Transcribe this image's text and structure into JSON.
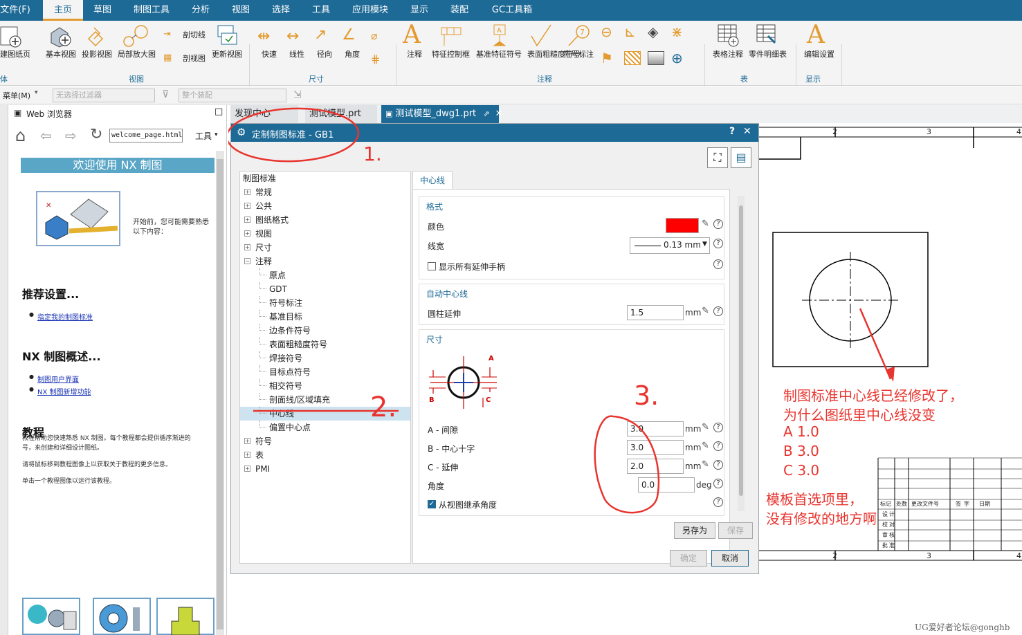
{
  "menu": {
    "file": "文件(F)",
    "tabs": [
      "主页",
      "草图",
      "制图工具",
      "分析",
      "视图",
      "选择",
      "工具",
      "应用模块",
      "显示",
      "装配",
      "GC工具箱"
    ]
  },
  "ribbon": {
    "view_group": {
      "new_sheet": "建图纸页",
      "base_view": "基本视图",
      "projected_view": "投影视图",
      "detail_view": "局部放大图",
      "section_line": "剖切线",
      "section_view": "剖视图",
      "update_view": "更新视图",
      "label": "视图"
    },
    "dim_group": {
      "rapid": "快速",
      "linear": "线性",
      "radial": "径向",
      "angular": "角度",
      "label": "尺寸"
    },
    "annot_group": {
      "note": "注释",
      "fcf": "特征控制框",
      "datum_feature": "基准特征符号",
      "surface_finish": "表面粗糙度符号",
      "id_symbol": "符号标注",
      "label": "注释"
    },
    "table_group": {
      "tabular_note": "表格注释",
      "parts_list": "零件明细表",
      "label": "表"
    },
    "display_group": {
      "edit_settings": "编辑设置",
      "label": "显示"
    },
    "left_cut": "体"
  },
  "filterbar": {
    "menu": "菜单(M)",
    "filter_placeholder": "无选择过滤器",
    "assembly_placeholder": "整个装配"
  },
  "webpanel": {
    "title": "Web 浏览器",
    "url": "welcome_page.html",
    "tools": "工具",
    "banner": "欢迎使用 NX 制图",
    "intro": [
      "开始前，您可能需要熟悉",
      "以下内容："
    ],
    "rec_heading": "推荐设置...",
    "rec_link": "指定我的制图标准",
    "overview_heading": "NX 制图概述...",
    "overview_links": [
      "制图用户界面",
      "NX 制图新增功能"
    ],
    "tut_heading": "教程",
    "tut_text": [
      "教程帮助您快速熟悉 NX 制图。每个教程都会提供循序渐进的",
      "号，来创建和详细设计图纸。",
      "请将鼠标移到教程图像上以获取关于教程的更多信息。",
      "单击一个教程图像以运行该教程。"
    ]
  },
  "doc_tabs": [
    "发现中心",
    "测试模型.prt",
    "测试模型_dwg1.prt"
  ],
  "dialog": {
    "title": "定制制图标准 - GB1",
    "help": "?",
    "close": "✕",
    "tree_header": "制图标准",
    "tree": [
      {
        "label": "常规",
        "level": 0,
        "toggle": "+"
      },
      {
        "label": "公共",
        "level": 0,
        "toggle": "+"
      },
      {
        "label": "图纸格式",
        "level": 0,
        "toggle": "+"
      },
      {
        "label": "视图",
        "level": 0,
        "toggle": "+"
      },
      {
        "label": "尺寸",
        "level": 0,
        "toggle": "+"
      },
      {
        "label": "注释",
        "level": 0,
        "toggle": "−"
      },
      {
        "label": "原点",
        "level": 1
      },
      {
        "label": "GDT",
        "level": 1
      },
      {
        "label": "符号标注",
        "level": 1
      },
      {
        "label": "基准目标",
        "level": 1
      },
      {
        "label": "边条件符号",
        "level": 1
      },
      {
        "label": "表面粗糙度符号",
        "level": 1
      },
      {
        "label": "焊接符号",
        "level": 1
      },
      {
        "label": "目标点符号",
        "level": 1
      },
      {
        "label": "相交符号",
        "level": 1
      },
      {
        "label": "剖面线/区域填充",
        "level": 1
      },
      {
        "label": "中心线",
        "level": 1,
        "selected": true
      },
      {
        "label": "偏置中心点",
        "level": 1
      },
      {
        "label": "符号",
        "level": 0,
        "toggle": "+"
      },
      {
        "label": "表",
        "level": 0,
        "toggle": "+"
      },
      {
        "label": "PMI",
        "level": 0,
        "toggle": "+"
      }
    ],
    "tab": "中心线",
    "format": {
      "title": "格式",
      "color_label": "颜色",
      "color": "#ff0000",
      "width_label": "线宽",
      "width_value": "0.13 mm",
      "show_handles": "显示所有延伸手柄"
    },
    "auto": {
      "title": "自动中心线",
      "ext_label": "圆柱延伸",
      "ext_value": "1.5",
      "unit": "mm"
    },
    "dims": {
      "title": "尺寸",
      "A_label": "A - 间隙",
      "A_value": "3.0",
      "B_label": "B - 中心十字",
      "B_value": "3.0",
      "C_label": "C - 延伸",
      "C_value": "2.0",
      "angle_label": "角度",
      "angle_value": "0.0",
      "angle_unit": "deg",
      "inherit": "从视图继承角度",
      "unit": "mm",
      "diag_A": "A",
      "diag_B": "B",
      "diag_C": "C"
    },
    "buttons": {
      "save_as": "另存为",
      "save": "保存",
      "ok": "确定",
      "cancel": "取消"
    }
  },
  "drawing": {
    "border_labels": [
      "2",
      "3",
      "4"
    ],
    "title_block": [
      "标记",
      "处数",
      "更改文件号",
      "签",
      "字",
      "日期",
      "设",
      "计",
      "校",
      "对",
      "审",
      "核",
      "批",
      "准"
    ]
  },
  "annotations": {
    "mark1": "1.",
    "mark2": "2.",
    "mark3": "3.",
    "question": [
      "制图标准中心线已经修改了，",
      "为什么图纸里中心线没变"
    ],
    "values": [
      "A    1.0",
      "B    3.0",
      "C    3.0"
    ],
    "note": [
      "模板首选项里，",
      "没有修改的地方啊"
    ],
    "accent": "#e8342e"
  },
  "watermark": "UG爱好者论坛@gonghb"
}
